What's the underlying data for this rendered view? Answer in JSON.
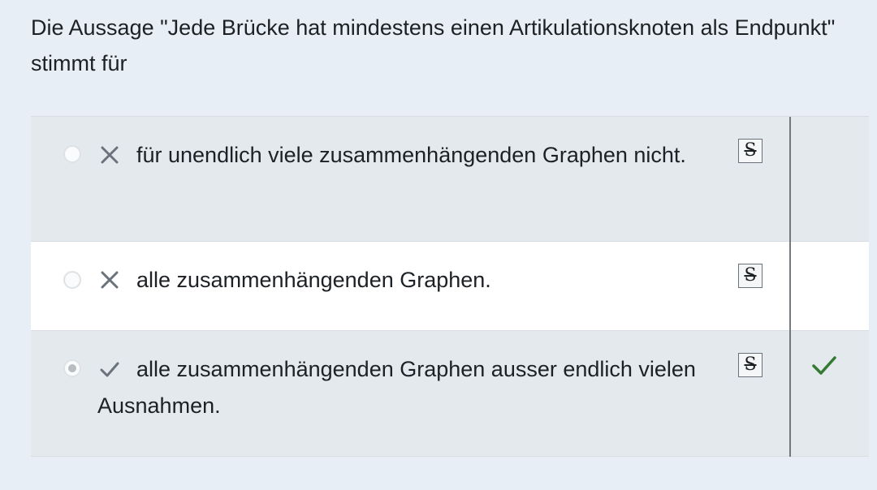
{
  "question": {
    "text": "Die Aussage \"Jede Brücke hat mindestens einen Artikulationsknoten als Endpunkt\" stimmt für"
  },
  "answers": [
    {
      "text": "für unendlich viele zusammenhängenden Graphen nicht.",
      "mark_icon": "cross-icon",
      "selected": false,
      "strike_label": "S"
    },
    {
      "text": "alle zusammenhängenden Graphen.",
      "mark_icon": "cross-icon",
      "selected": false,
      "strike_label": "S"
    },
    {
      "text": "alle zusammenhängenden Graphen ausser endlich vielen Ausnahmen.",
      "mark_icon": "check-icon",
      "selected": true,
      "strike_label": "S",
      "feedback_icon": "check-icon"
    }
  ],
  "colors": {
    "page_background": "#e7eef6",
    "row_shaded": "#e4e9ee",
    "row_white": "#ffffff",
    "correct_green": "#357a32",
    "mark_gray": "#6a737b"
  }
}
